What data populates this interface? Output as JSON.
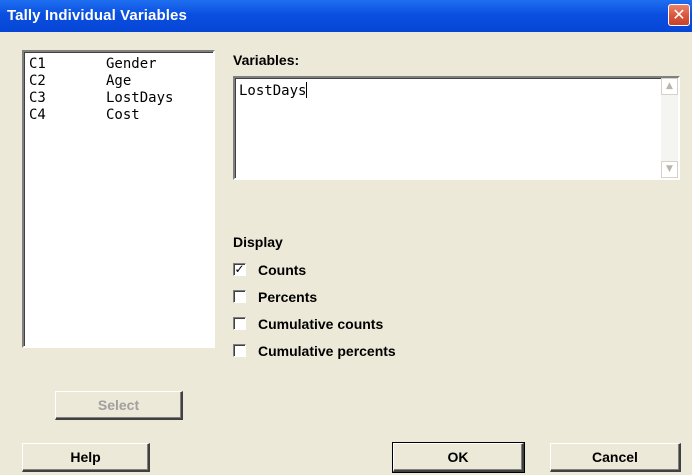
{
  "window": {
    "title": "Tally Individual Variables",
    "close_symbol": "✕"
  },
  "variable_list": [
    {
      "column": "C1",
      "name": "Gender"
    },
    {
      "column": "C2",
      "name": "Age"
    },
    {
      "column": "C3",
      "name": "LostDays"
    },
    {
      "column": "C4",
      "name": "Cost"
    }
  ],
  "variables": {
    "label": "Variables:",
    "value": "LostDays"
  },
  "display": {
    "label": "Display",
    "options": [
      {
        "label": "Counts",
        "checked": true
      },
      {
        "label": "Percents",
        "checked": false
      },
      {
        "label": "Cumulative counts",
        "checked": false
      },
      {
        "label": "Cumulative percents",
        "checked": false
      }
    ]
  },
  "buttons": {
    "select": "Select",
    "help": "Help",
    "ok": "OK",
    "cancel": "Cancel"
  },
  "colors": {
    "titlebar": "#0a4fe0",
    "dialog_bg": "#ece9d8",
    "close_button": "#d8553a"
  },
  "icons": {
    "close": "close-icon",
    "scroll_up": "scroll-up-arrow-icon",
    "scroll_down": "scroll-down-arrow-icon",
    "check": "checkmark-icon"
  }
}
